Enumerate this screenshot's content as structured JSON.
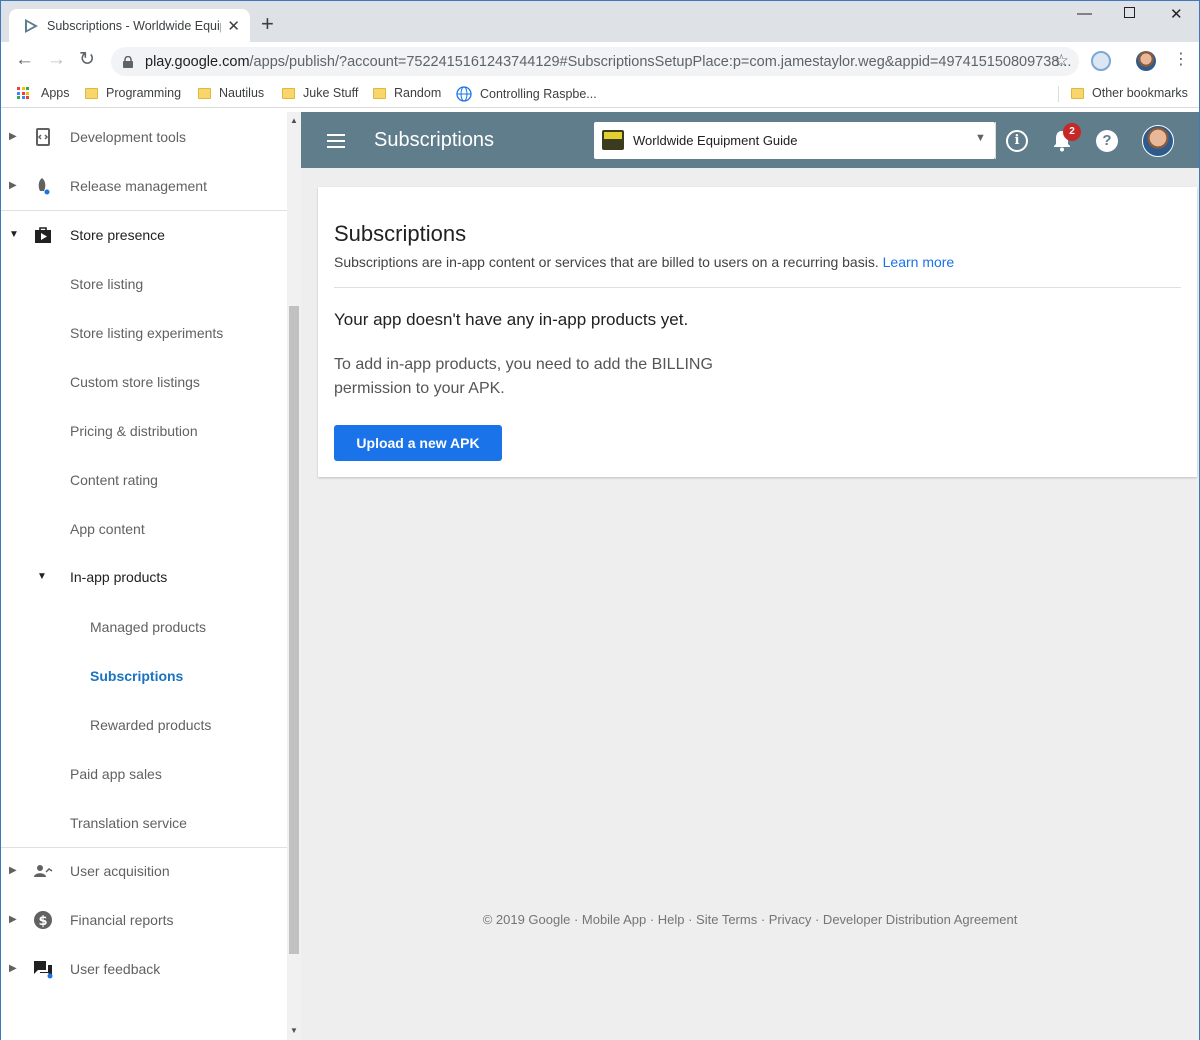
{
  "browser": {
    "tab_title": "Subscriptions - Worldwide Equip",
    "url_host": "play.google.com",
    "url_path": "/apps/publish/?account=7522415161243744129#SubscriptionsSetupPlace:p=com.jamestaylor.weg&appid=497415150809738..."
  },
  "bookmarks": {
    "apps": "Apps",
    "items": [
      "Programming",
      "Nautilus",
      "Juke Stuff",
      "Random",
      "Controlling Raspbe..."
    ],
    "other": "Other bookmarks"
  },
  "sidebar": {
    "items": [
      {
        "label": "Development tools",
        "icon": "code-icon"
      },
      {
        "label": "Release management",
        "icon": "rocket-icon"
      },
      {
        "label": "Store presence",
        "icon": "store-icon"
      },
      {
        "label": "Store listing"
      },
      {
        "label": "Store listing experiments"
      },
      {
        "label": "Custom store listings"
      },
      {
        "label": "Pricing & distribution"
      },
      {
        "label": "Content rating"
      },
      {
        "label": "App content"
      },
      {
        "label": "In-app products"
      },
      {
        "label": "Managed products"
      },
      {
        "label": "Subscriptions"
      },
      {
        "label": "Rewarded products"
      },
      {
        "label": "Paid app sales"
      },
      {
        "label": "Translation service"
      },
      {
        "label": "User acquisition",
        "icon": "user-acquisition-icon"
      },
      {
        "label": "Financial reports",
        "icon": "dollar-icon"
      },
      {
        "label": "User feedback",
        "icon": "feedback-icon"
      }
    ]
  },
  "appbar": {
    "title": "Subscriptions",
    "app_name": "Worldwide Equipment Guide",
    "notification_count": "2",
    "help": "?",
    "info": "i"
  },
  "card": {
    "title": "Subscriptions",
    "subtitle": "Subscriptions are in-app content or services that are billed to users on a recurring basis.",
    "learn_more": "Learn more",
    "empty_title": "Your app doesn't have any in-app products yet.",
    "empty_body": "To add in-app products, you need to add the BILLING permission to your APK.",
    "upload_button": "Upload a new APK"
  },
  "footer": {
    "text": "© 2019 Google · Mobile App · Help · Site Terms · Privacy · Developer Distribution Agreement"
  },
  "colors": {
    "appbar": "#607d8b",
    "primary": "#1a73e8",
    "active_nav": "#1a73c2"
  }
}
